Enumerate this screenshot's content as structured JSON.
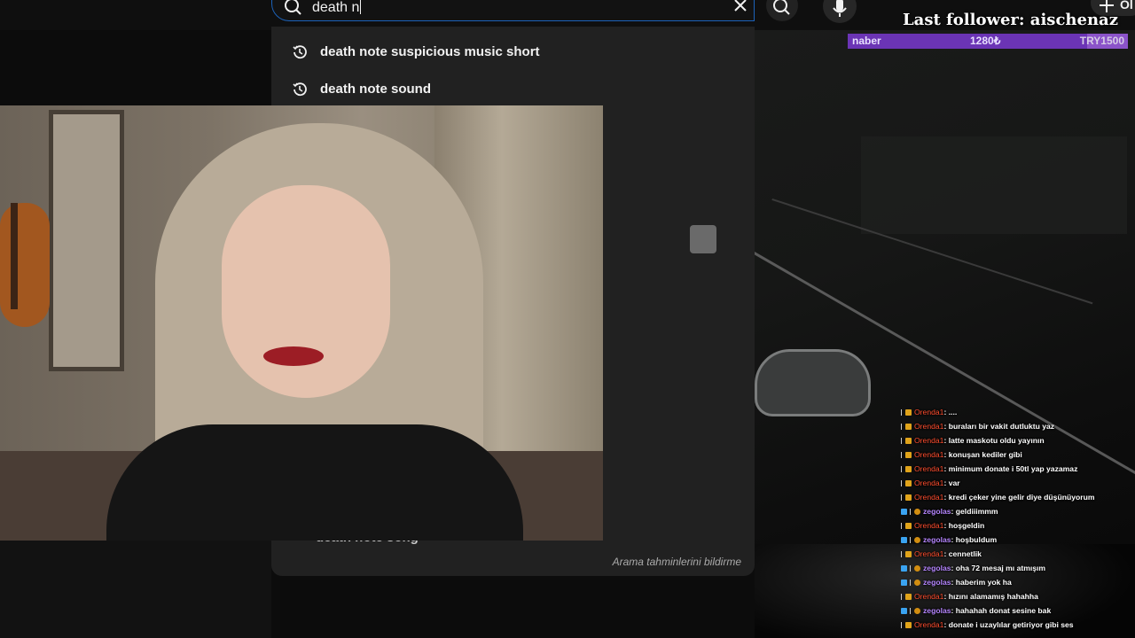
{
  "search": {
    "query": "death n",
    "suggestions": [
      {
        "label": "death note suspicious music short",
        "icon": "history-icon"
      },
      {
        "label": "death note sound",
        "icon": "history-icon"
      }
    ],
    "partially_hidden_suggestion": "death note song",
    "report_link": "Arama tahminlerini bildirme"
  },
  "header": {
    "create_label": "Ol"
  },
  "overlay": {
    "last_follower": "Last follower: aischenaz",
    "goal": {
      "name": "naber",
      "amount": "1280₺",
      "target": "TRY1500",
      "progress": 0.853
    }
  },
  "chat": [
    {
      "user": "Orenda1",
      "text": ": ....",
      "badges": [
        "bar",
        "mod"
      ]
    },
    {
      "user": "Orenda1",
      "text": ": buraları bir vakit dutluktu yaz",
      "badges": [
        "bar",
        "mod"
      ]
    },
    {
      "user": "Orenda1",
      "text": ": latte maskotu oldu yayının",
      "badges": [
        "bar",
        "mod"
      ]
    },
    {
      "user": "Orenda1",
      "text": ": konuşan kediler gibi",
      "badges": [
        "bar",
        "mod"
      ]
    },
    {
      "user": "Orenda1",
      "text": ": minimum donate i 50tl yap yazamaz",
      "badges": [
        "bar",
        "mod"
      ]
    },
    {
      "user": "Orenda1",
      "text": ": var",
      "badges": [
        "bar",
        "mod"
      ]
    },
    {
      "user": "Orenda1",
      "text": ": kredi çeker yine gelir diye düşünüyorum",
      "badges": [
        "bar",
        "mod"
      ]
    },
    {
      "user": "zegolas",
      "text": ": geldiiimmm",
      "badges": [
        "sub",
        "bar",
        "coin"
      ]
    },
    {
      "user": "Orenda1",
      "text": ": hoşgeldin",
      "badges": [
        "bar",
        "mod"
      ]
    },
    {
      "user": "zegolas",
      "text": ": hoşbuldum",
      "badges": [
        "sub",
        "bar",
        "coin"
      ]
    },
    {
      "user": "Orenda1",
      "text": ": cennetlik",
      "badges": [
        "bar",
        "mod"
      ]
    },
    {
      "user": "zegolas",
      "text": ": oha 72 mesaj mı atmışım",
      "badges": [
        "sub",
        "bar",
        "coin"
      ]
    },
    {
      "user": "zegolas",
      "text": ": haberim yok ha",
      "badges": [
        "sub",
        "bar",
        "coin"
      ]
    },
    {
      "user": "Orenda1",
      "text": ": hızını alamamış hahahha",
      "badges": [
        "bar",
        "mod"
      ]
    },
    {
      "user": "zegolas",
      "text": ": hahahah donat sesine bak",
      "badges": [
        "sub",
        "bar",
        "coin"
      ]
    },
    {
      "user": "Orenda1",
      "text": ": donate i uzaylılar getiriyor gibi ses",
      "badges": [
        "bar",
        "mod"
      ]
    }
  ]
}
